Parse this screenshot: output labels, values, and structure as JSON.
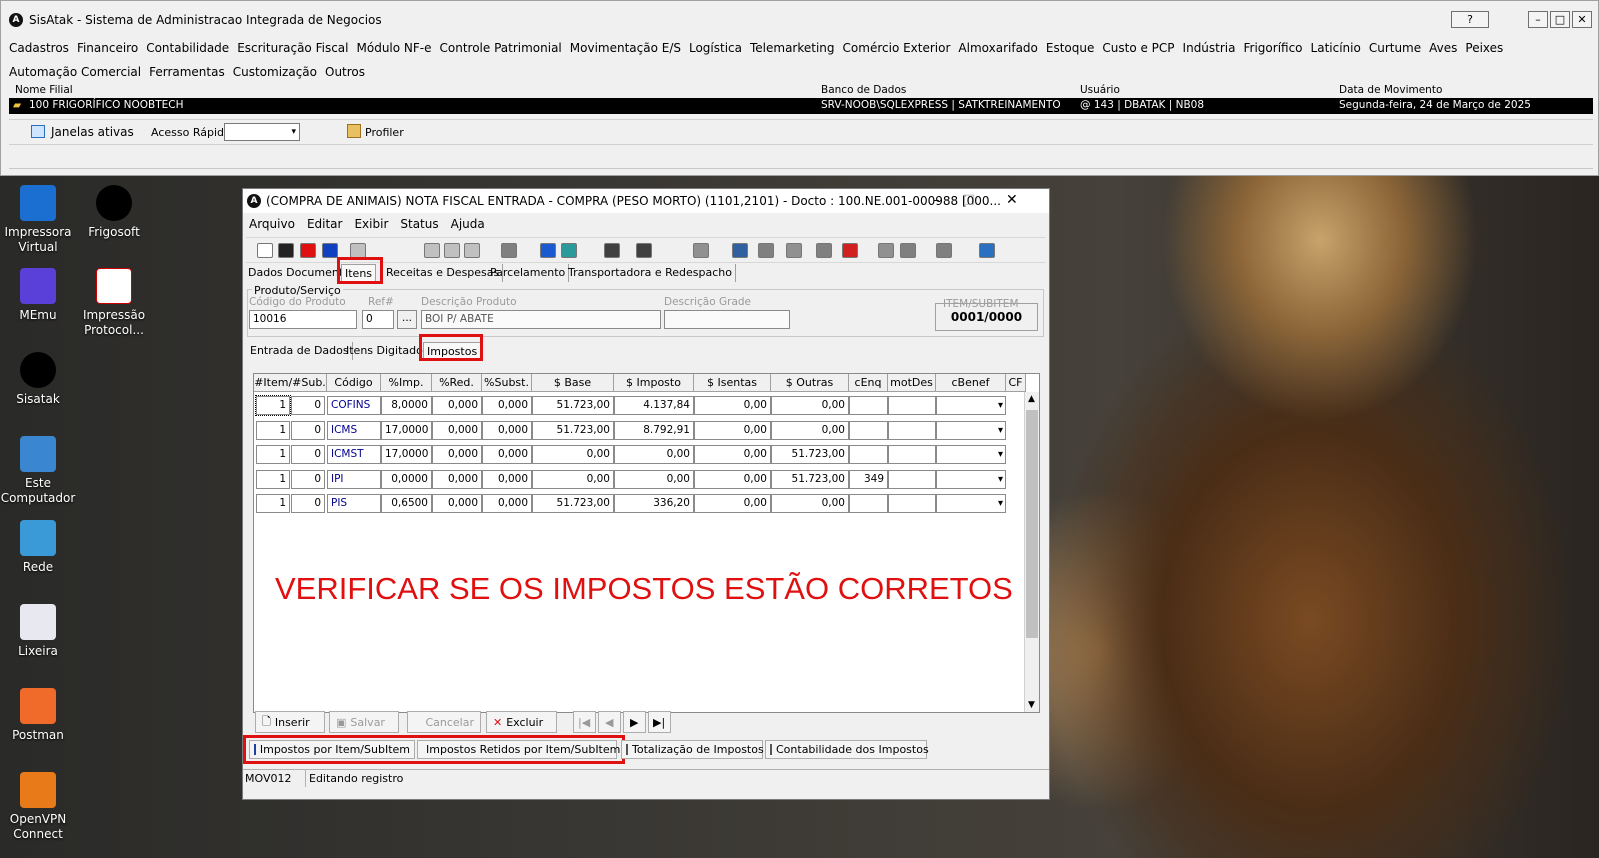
{
  "app": {
    "title": "SisAtak - Sistema de Administracao Integrada de Negocios",
    "help": "?",
    "logo": "A"
  },
  "menu": [
    "Cadastros",
    "Financeiro",
    "Contabilidade",
    "Escrituração Fiscal",
    "Módulo NF-e",
    "Controle Patrimonial",
    "Movimentação E/S",
    "Logística",
    "Telemarketing",
    "Comércio Exterior",
    "Almoxarifado",
    "Estoque",
    "Custo e PCP",
    "Indústria",
    "Frigorífico",
    "Laticínio",
    "Curtume",
    "Aves",
    "Peixes",
    "Automação Comercial",
    "Ferramentas",
    "Customização",
    "Outros"
  ],
  "info": {
    "h1": "Nome Filial",
    "h2": "Banco de Dados",
    "h3": "Usuário",
    "h4": "Data de Movimento",
    "filial": "100 FRIGORÍFICO NOOBTECH",
    "db": "SRV-NOOB\\SQLEXPRESS | SATKTREINAMENTO",
    "user": "@ 143 | DBATAK | NB08",
    "date": "Segunda-feira, 24 de Março de 2025"
  },
  "toolbar2": {
    "janelas": "Janelas ativas",
    "acesso": "Acesso Rápido",
    "profiler": "Profiler"
  },
  "desktop": [
    {
      "label": "Impressora Virtual",
      "icon": "printer-icon"
    },
    {
      "label": "Frigosoft",
      "icon": "frigosoft-icon"
    },
    {
      "label": "MEmu",
      "icon": "memu-icon"
    },
    {
      "label": "Impressão Protocol...",
      "icon": "pdf-icon"
    },
    {
      "label": "Sisatak",
      "icon": "sisatak-icon"
    },
    {
      "label": "Este Computador",
      "icon": "computer-icon"
    },
    {
      "label": "Rede",
      "icon": "network-icon"
    },
    {
      "label": "Lixeira",
      "icon": "recycle-bin-icon"
    },
    {
      "label": "Postman",
      "icon": "postman-icon"
    },
    {
      "label": "OpenVPN Connect",
      "icon": "openvpn-icon"
    }
  ],
  "win": {
    "title": "(COMPRA DE ANIMAIS) NOTA FISCAL ENTRADA - COMPRA (PESO MORTO) (1101,2101) - Docto : 100.NE.001-000988 [000...",
    "menu": [
      "Arquivo",
      "Editar",
      "Exibir",
      "Status",
      "Ajuda"
    ],
    "tabs": [
      "Dados Documento",
      "Itens",
      "Receitas e Despesas",
      "Parcelamento",
      "Transportadora e Redespacho"
    ],
    "group": "Produto/Serviço",
    "lbl_cod": "Código do Produto",
    "lbl_ref": "Ref#",
    "lbl_desc": "Descrição Produto",
    "lbl_grade": "Descrição Grade",
    "lbl_item": "ITEM/SUBITEM",
    "cod": "10016",
    "ref": "0",
    "more": "...",
    "desc": "BOI P/ ABATE",
    "grade": "",
    "item": "0001/0000",
    "subtabs": [
      "Entrada de Dados",
      "Itens Digitados",
      "Impostos"
    ],
    "cols": [
      "#Item/#Sub.",
      "Código",
      "%Imp.",
      "%Red.",
      "%Subst.",
      "$ Base",
      "$ Imposto",
      "$ Isentas",
      "$ Outras",
      "cEnq",
      "motDes",
      "cBenef",
      "CF"
    ],
    "rows": [
      [
        "1",
        "0",
        "COFINS",
        "8,0000",
        "0,000",
        "0,000",
        "51.723,00",
        "4.137,84",
        "0,00",
        "0,00",
        "",
        ""
      ],
      [
        "1",
        "0",
        "ICMS",
        "17,0000",
        "0,000",
        "0,000",
        "51.723,00",
        "8.792,91",
        "0,00",
        "0,00",
        "",
        ""
      ],
      [
        "1",
        "0",
        "ICMST",
        "17,0000",
        "0,000",
        "0,000",
        "0,00",
        "0,00",
        "0,00",
        "51.723,00",
        "",
        ""
      ],
      [
        "1",
        "0",
        "IPI",
        "0,0000",
        "0,000",
        "0,000",
        "0,00",
        "0,00",
        "0,00",
        "51.723,00",
        "349",
        ""
      ],
      [
        "1",
        "0",
        "PIS",
        "0,6500",
        "0,000",
        "0,000",
        "51.723,00",
        "336,20",
        "0,00",
        "0,00",
        "",
        ""
      ]
    ],
    "note": "VERIFICAR SE OS IMPOSTOS ESTÃO CORRETOS",
    "buttons": {
      "inserir": "Inserir",
      "salvar": "Salvar",
      "cancelar": "Cancelar",
      "excluir": "Excluir"
    },
    "btabs": [
      "Impostos por Item/SubItem",
      "Impostos Retidos por Item/SubItem",
      "Totalização de Impostos",
      "Contabilidade dos Impostos"
    ],
    "status1": "MOV012",
    "status2": "Editando registro"
  }
}
